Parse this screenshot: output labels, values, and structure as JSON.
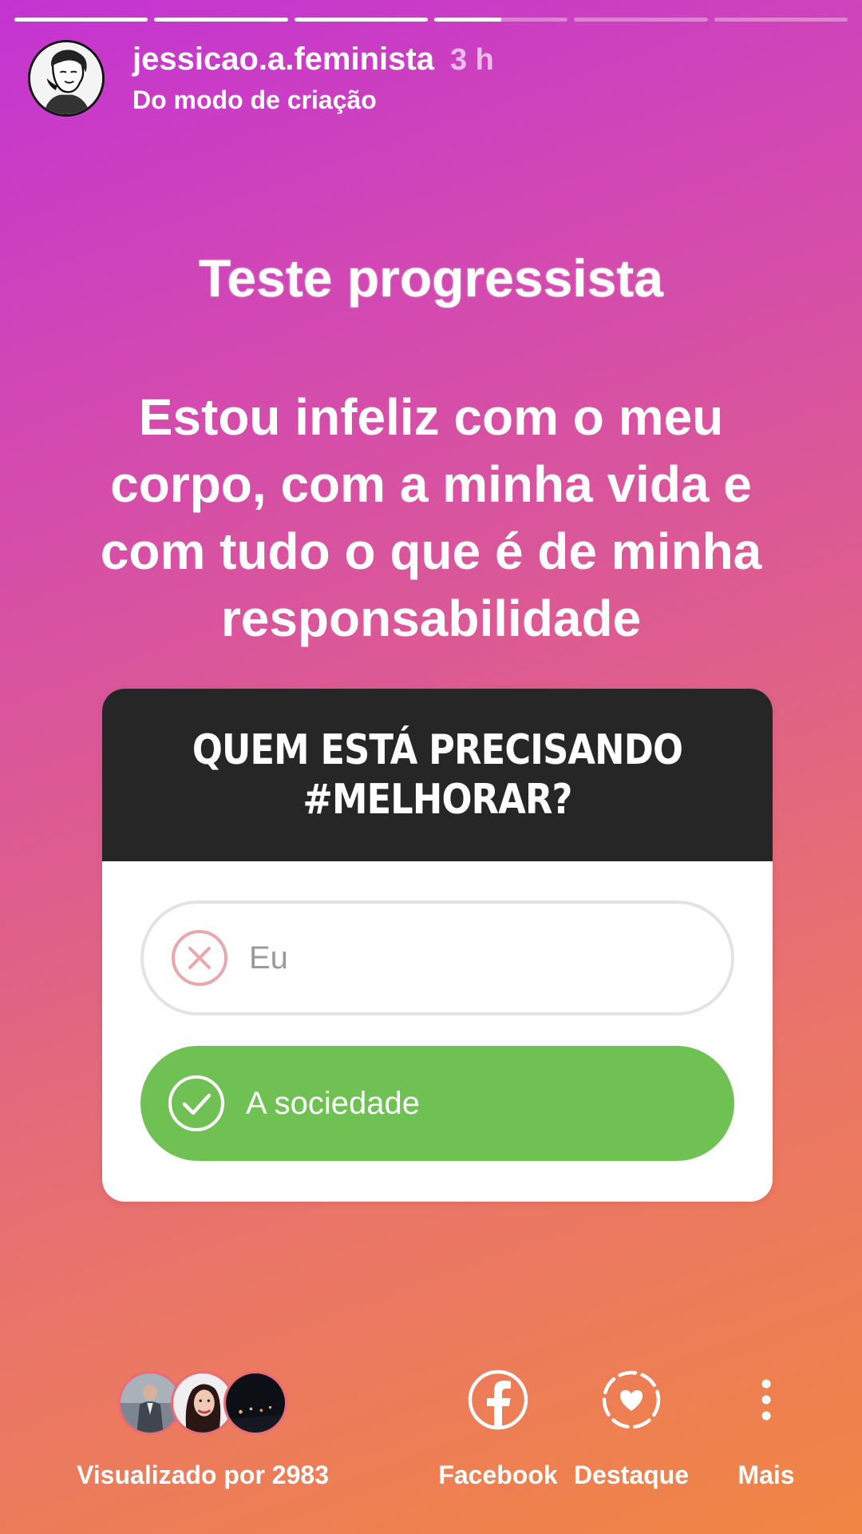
{
  "story": {
    "progress": [
      1,
      1,
      1,
      0.5,
      0,
      0
    ]
  },
  "header": {
    "username": "jessicao.a.feminista",
    "time": "3 h",
    "source": "Do modo de criação",
    "avatar_icon": "profile-avatar-icon"
  },
  "content": {
    "title": "Teste progressista",
    "statement": "Estou infeliz com o meu corpo, com a minha vida e com tudo o que é de minha responsabilidade"
  },
  "poll": {
    "question": "QUEM ESTÁ PRECISANDO #MELHORAR?",
    "options": [
      {
        "label": "Eu",
        "icon": "x-circle-icon",
        "state": "wrong",
        "color": "#e8a7ad"
      },
      {
        "label": "A sociedade",
        "icon": "check-circle-icon",
        "state": "correct",
        "color": "#70c153"
      }
    ]
  },
  "footer": {
    "viewed_label": "Visualizado por 2983",
    "actions": [
      {
        "label": "Facebook",
        "icon": "facebook-icon"
      },
      {
        "label": "Destaque",
        "icon": "highlight-heart-icon"
      },
      {
        "label": "Mais",
        "icon": "more-vertical-icon"
      }
    ]
  },
  "colors": {
    "gradient_start": "#c334d2",
    "gradient_end": "#f08643",
    "poll_header": "#262626",
    "correct": "#70c153"
  }
}
